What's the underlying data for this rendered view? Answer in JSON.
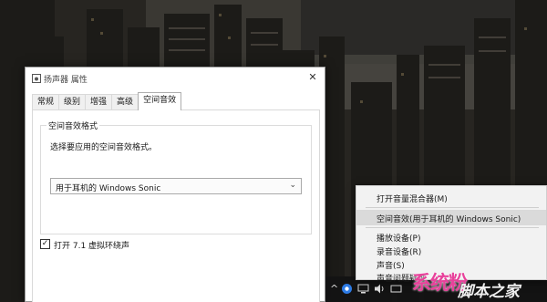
{
  "dialog": {
    "title": "扬声器 属性",
    "close_glyph": "✕",
    "tabs": [
      {
        "label": "常规"
      },
      {
        "label": "级别"
      },
      {
        "label": "增强"
      },
      {
        "label": "高级"
      },
      {
        "label": "空间音效",
        "active": true
      }
    ],
    "group_title": "空间音效格式",
    "group_desc": "选择要应用的空间音效格式。",
    "select_value": "用于耳机的 Windows Sonic",
    "select_arrow_glyph": "⌄",
    "checkbox": {
      "checked": true,
      "glyph": "✓",
      "label": "打开 7.1 虚拟环绕声"
    }
  },
  "context_menu": {
    "items": [
      {
        "label": "打开音量混合器(M)"
      },
      {
        "label": "空间音效(用于耳机的 Windows Sonic)",
        "highlighted": true
      },
      {
        "label": "播放设备(P)"
      },
      {
        "label": "录音设备(R)"
      },
      {
        "label": "声音(S)"
      },
      {
        "label": "声音问题疑难..."
      }
    ]
  },
  "taskbar": {
    "chevron_glyph": "^"
  },
  "watermark": {
    "main": "脚本之家",
    "overlay": "系统粉"
  },
  "colors": {
    "dialog_bg": "#ffffff",
    "menu_bg": "#f2f2f2",
    "menu_highlight": "#dadada",
    "taskbar_bg": "#121214",
    "watermark_pink": "#e8429b"
  }
}
